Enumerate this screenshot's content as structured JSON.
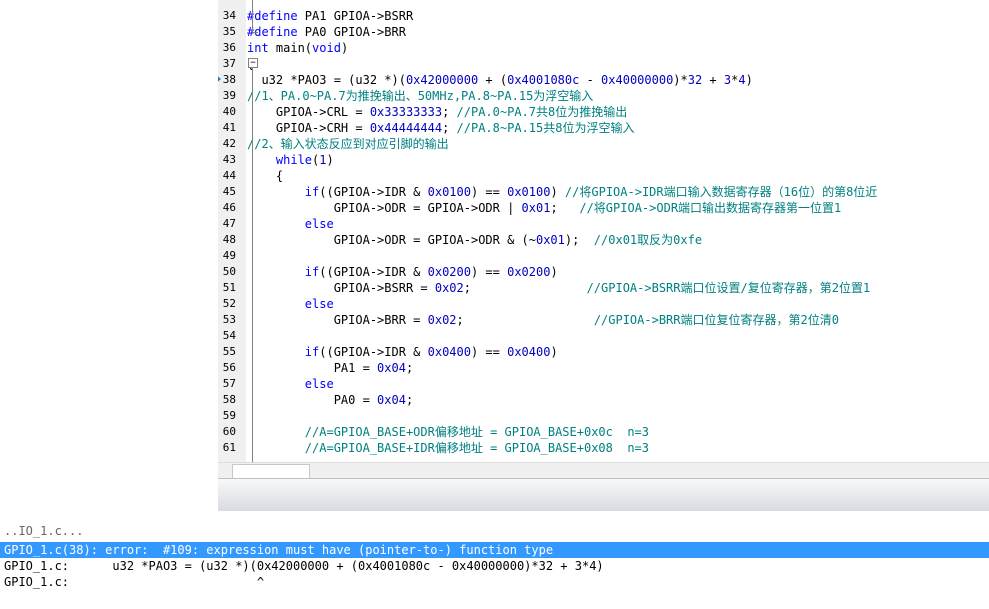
{
  "editor": {
    "lines": [
      {
        "n": "34",
        "code": "#define PA1 GPIOA->BSRR"
      },
      {
        "n": "35",
        "code": "#define PA0 GPIOA->BRR"
      },
      {
        "n": "36",
        "code": "int main(void)"
      },
      {
        "n": "37",
        "code": "{"
      },
      {
        "n": "38",
        "code": "  u32 *PAO3 = (u32 *)(0x42000000 + (0x4001080c - 0x40000000)*32 + 3*4)"
      },
      {
        "n": "39",
        "code": "//1、PA.0~PA.7为推挽输出、50MHz,PA.8~PA.15为浮空输入"
      },
      {
        "n": "40",
        "code": "    GPIOA->CRL = 0x33333333; //PA.0~PA.7共8位为推挽输出"
      },
      {
        "n": "41",
        "code": "    GPIOA->CRH = 0x44444444; //PA.8~PA.15共8位为浮空输入"
      },
      {
        "n": "42",
        "code": "//2、输入状态反应到对应引脚的输出"
      },
      {
        "n": "43",
        "code": "    while(1)"
      },
      {
        "n": "44",
        "code": "    {"
      },
      {
        "n": "45",
        "code": "        if((GPIOA->IDR & 0x0100) == 0x0100) //将GPIOA->IDR端口输入数据寄存器（16位）的第8位近"
      },
      {
        "n": "46",
        "code": "            GPIOA->ODR = GPIOA->ODR | 0x01;   //将GPIOA->ODR端口输出数据寄存器第一位置1"
      },
      {
        "n": "47",
        "code": "        else"
      },
      {
        "n": "48",
        "code": "            GPIOA->ODR = GPIOA->ODR & (~0x01);  //0x01取反为0xfe"
      },
      {
        "n": "49",
        "code": ""
      },
      {
        "n": "50",
        "code": "        if((GPIOA->IDR & 0x0200) == 0x0200)"
      },
      {
        "n": "51",
        "code": "            GPIOA->BSRR = 0x02;                //GPIOA->BSRR端口位设置/复位寄存器，第2位置1"
      },
      {
        "n": "52",
        "code": "        else"
      },
      {
        "n": "53",
        "code": "            GPIOA->BRR = 0x02;                  //GPIOA->BRR端口位复位寄存器，第2位清0"
      },
      {
        "n": "54",
        "code": ""
      },
      {
        "n": "55",
        "code": "        if((GPIOA->IDR & 0x0400) == 0x0400)"
      },
      {
        "n": "56",
        "code": "            PA1 = 0x04;"
      },
      {
        "n": "57",
        "code": "        else"
      },
      {
        "n": "58",
        "code": "            PA0 = 0x04;"
      },
      {
        "n": "59",
        "code": ""
      },
      {
        "n": "60",
        "code": "        //A=GPIOA_BASE+ODR偏移地址 = GPIOA_BASE+0x0c  n=3"
      },
      {
        "n": "61",
        "code": "        //A=GPIOA_BASE+IDR偏移地址 = GPIOA_BASE+0x08  n=3"
      }
    ],
    "current_line": "38",
    "fold_marker": "−"
  },
  "output": {
    "partial_line": "..IO_1.c...",
    "error_line": "GPIO_1.c(38): error:  #109: expression must have (pointer-to-) function type",
    "source_line": "GPIO_1.c:      u32 *PAO3 = (u32 *)(0x42000000 + (0x4001080c - 0x40000000)*32 + 3*4)",
    "caret_line": "GPIO_1.c:                          ^"
  },
  "colors": {
    "keyword": "#0000ff",
    "comment": "#008080",
    "selection": "#3399ff",
    "current_line_arrow": "#1f7bd6"
  }
}
